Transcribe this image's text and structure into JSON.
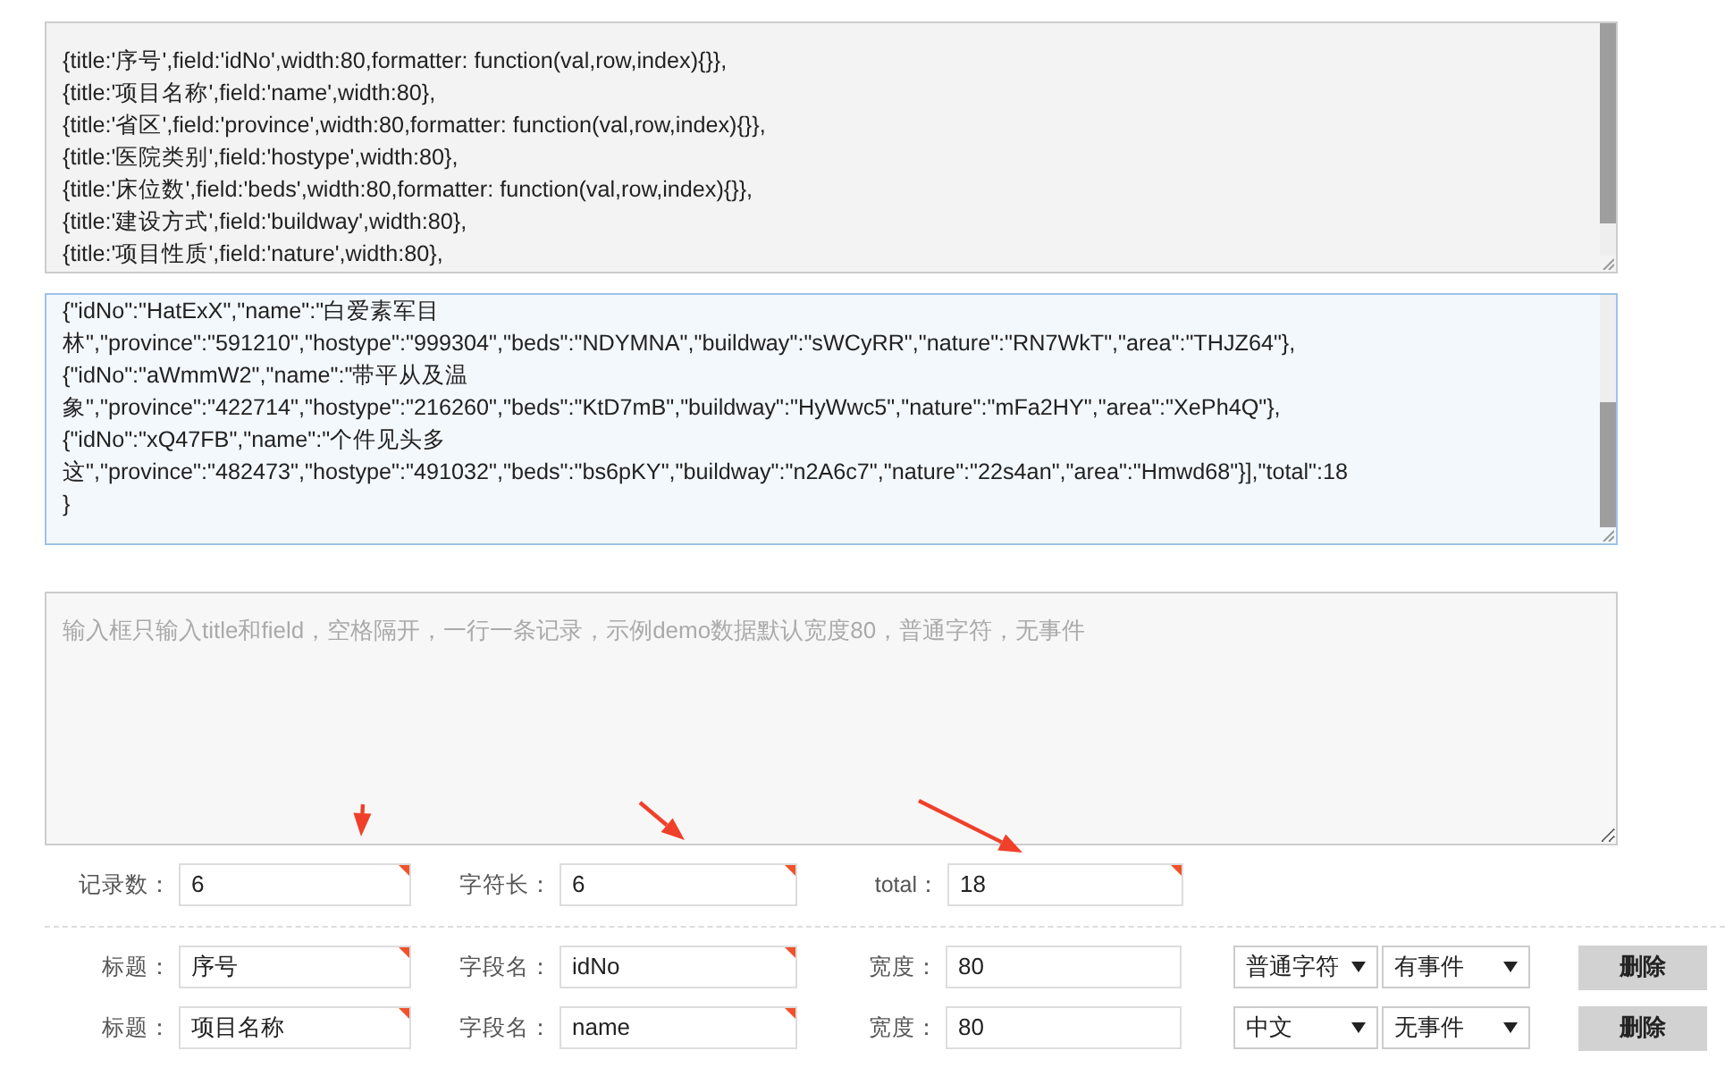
{
  "code_box": {
    "lines": [
      "{title:'序号',field:'idNo',width:80,formatter: function(val,row,index){}},",
      "{title:'项目名称',field:'name',width:80},",
      "{title:'省区',field:'province',width:80,formatter: function(val,row,index){}},",
      "{title:'医院类别',field:'hostype',width:80},",
      "{title:'床位数',field:'beds',width:80,formatter: function(val,row,index){}},",
      "{title:'建设方式',field:'buildway',width:80},",
      "{title:'项目性质',field:'nature',width:80},"
    ]
  },
  "data_box": {
    "lines": [
      "{\"idNo\":\"HatExX\",\"name\":\"白爱素军目",
      "林\",\"province\":\"591210\",\"hostype\":\"999304\",\"beds\":\"NDYMNA\",\"buildway\":\"sWCyRR\",\"nature\":\"RN7WkT\",\"area\":\"THJZ64\"},",
      "{\"idNo\":\"aWmmW2\",\"name\":\"带平从及温",
      "象\",\"province\":\"422714\",\"hostype\":\"216260\",\"beds\":\"KtD7mB\",\"buildway\":\"HyWwc5\",\"nature\":\"mFa2HY\",\"area\":\"XePh4Q\"},",
      "{\"idNo\":\"xQ47FB\",\"name\":\"个件见头多",
      "这\",\"province\":\"482473\",\"hostype\":\"491032\",\"beds\":\"bs6pKY\",\"buildway\":\"n2A6c7\",\"nature\":\"22s4an\",\"area\":\"Hmwd68\"}],\"total\":18",
      "}"
    ]
  },
  "input_box": {
    "placeholder": "输入框只输入title和field，空格隔开，一行一条记录，示例demo数据默认宽度80，普通字符，无事件"
  },
  "summary": [
    {
      "label": "记录数：",
      "value": "6",
      "flagged": true
    },
    {
      "label": "字符长：",
      "value": "6",
      "flagged": true
    },
    {
      "label": "total：",
      "value": "18",
      "flagged": true
    }
  ],
  "columns": [
    {
      "title_label": "标题：",
      "title": {
        "value": "序号",
        "flagged": true
      },
      "field_label": "字段名：",
      "field": {
        "value": "idNo",
        "flagged": true
      },
      "width_label": "宽度：",
      "width": {
        "value": "80",
        "flagged": false
      },
      "char_type": "普通字符",
      "event": "有事件",
      "delete": "删除"
    },
    {
      "title_label": "标题：",
      "title": {
        "value": "项目名称",
        "flagged": true
      },
      "field_label": "字段名：",
      "field": {
        "value": "name",
        "flagged": true
      },
      "width_label": "宽度：",
      "width": {
        "value": "80",
        "flagged": false
      },
      "char_type": "中文",
      "event": "无事件",
      "delete": "删除"
    }
  ]
}
